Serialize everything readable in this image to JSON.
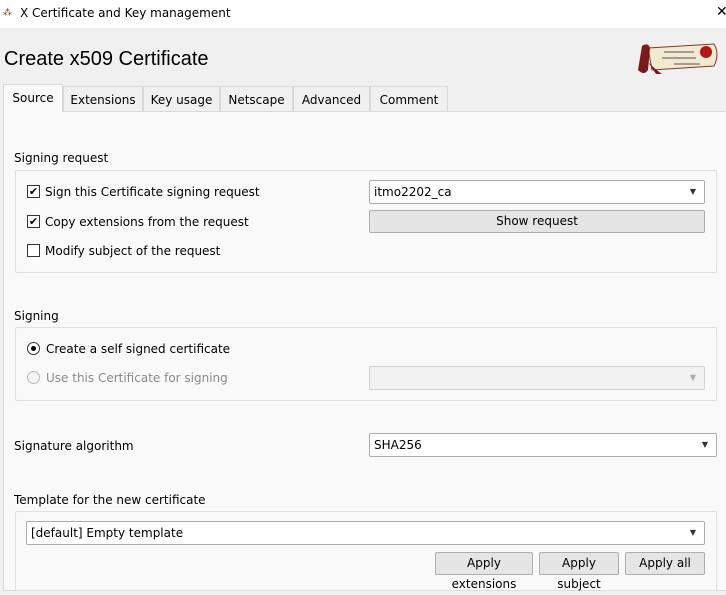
{
  "window": {
    "title": "X Certificate and Key management",
    "close": "✕"
  },
  "header": {
    "title": "Create x509 Certificate"
  },
  "tabs": [
    {
      "label": "Source"
    },
    {
      "label": "Extensions"
    },
    {
      "label": "Key usage"
    },
    {
      "label": "Netscape"
    },
    {
      "label": "Advanced"
    },
    {
      "label": "Comment"
    }
  ],
  "signing_request": {
    "title": "Signing request",
    "sign_csr": {
      "label": "Sign this Certificate signing request",
      "checked": true
    },
    "copy_ext": {
      "label": "Copy extensions from the request",
      "checked": true
    },
    "modify_subject": {
      "label": "Modify subject of the request",
      "checked": false
    },
    "request_select": "itmo2202_ca",
    "show_request": "Show request"
  },
  "signing": {
    "title": "Signing",
    "self_signed": {
      "label": "Create a self signed certificate",
      "selected": true
    },
    "use_cert": {
      "label": "Use this Certificate for signing",
      "selected": false
    },
    "cert_select": ""
  },
  "signature": {
    "label": "Signature algorithm",
    "value": "SHA256"
  },
  "template": {
    "title": "Template for the new certificate",
    "value": "[default] Empty template",
    "apply_extensions": "Apply extensions",
    "apply_subject": "Apply subject",
    "apply_all": "Apply all"
  },
  "checkmark": "✔",
  "dropdown_arrow": "▼"
}
